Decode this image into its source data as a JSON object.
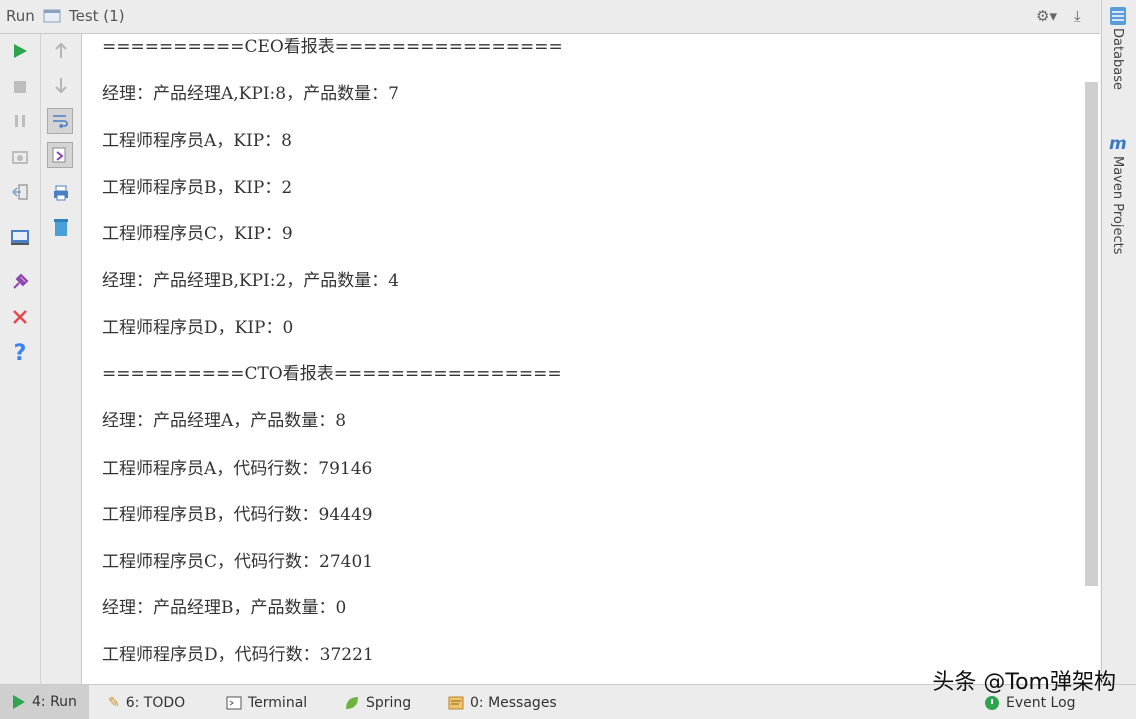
{
  "header": {
    "run_label": "Run",
    "tab_name": "Test (1)"
  },
  "console_lines": [
    "==========CEO看报表================",
    "经理：产品经理A,KPI:8，产品数量：7",
    "工程师程序员A，KIP：8",
    "工程师程序员B，KIP：2",
    "工程师程序员C，KIP：9",
    "经理：产品经理B,KPI:2，产品数量：4",
    "工程师程序员D，KIP：0",
    "==========CTO看报表================",
    "经理：产品经理A，产品数量：8",
    "工程师程序员A，代码行数：79146",
    "工程师程序员B，代码行数：94449",
    "工程师程序员C，代码行数：27401",
    "经理：产品经理B，产品数量：0",
    "工程师程序员D，代码行数：37221"
  ],
  "right_sidebar": {
    "database": "Database",
    "maven": "Maven Projects"
  },
  "statusbar": {
    "run": "4: Run",
    "todo": "6: TODO",
    "terminal": "Terminal",
    "spring": "Spring",
    "messages": "0: Messages",
    "event_log": "Event Log"
  },
  "watermark": "头条 @Tom弹架构",
  "colors": {
    "run_green": "#2ea44f",
    "stop_red": "#e5484d",
    "help_blue": "#3b82f6"
  }
}
